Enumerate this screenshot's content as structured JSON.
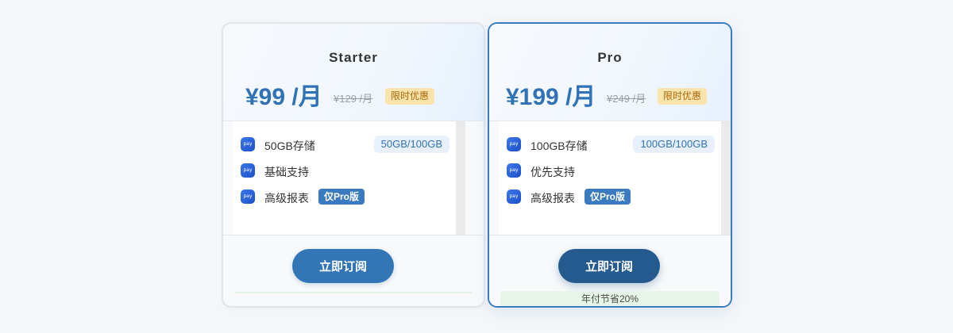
{
  "plans": [
    {
      "name": "Starter",
      "price": "¥99 /月",
      "old_price": "¥129 /月",
      "promo_badge": "限时优惠",
      "features": [
        {
          "icon": "pay-icon",
          "label": "50GB存储",
          "usage": "50GB/100GB"
        },
        {
          "icon": "pay-icon",
          "label": "基础支持"
        },
        {
          "icon": "pay-icon",
          "label": "高级报表",
          "badge": "仅Pro版"
        }
      ],
      "cta_label": "立即订阅"
    },
    {
      "name": "Pro",
      "price": "¥199 /月",
      "old_price": "¥249 /月",
      "promo_badge": "限时优惠",
      "features": [
        {
          "icon": "pay-icon",
          "label": "100GB存储",
          "usage": "100GB/100GB"
        },
        {
          "icon": "pay-icon",
          "label": "优先支持"
        },
        {
          "icon": "pay-icon",
          "label": "高级报表",
          "badge": "仅Pro版"
        }
      ],
      "cta_label": "立即订阅",
      "savings_note": "年付节省20%"
    }
  ],
  "colors": {
    "accent": "#2f72b6",
    "pro_border": "#3a7bbf",
    "promo_bg": "#fbe3ac",
    "savings_bg": "#e7f4e8"
  },
  "icon_glyph": "pay"
}
